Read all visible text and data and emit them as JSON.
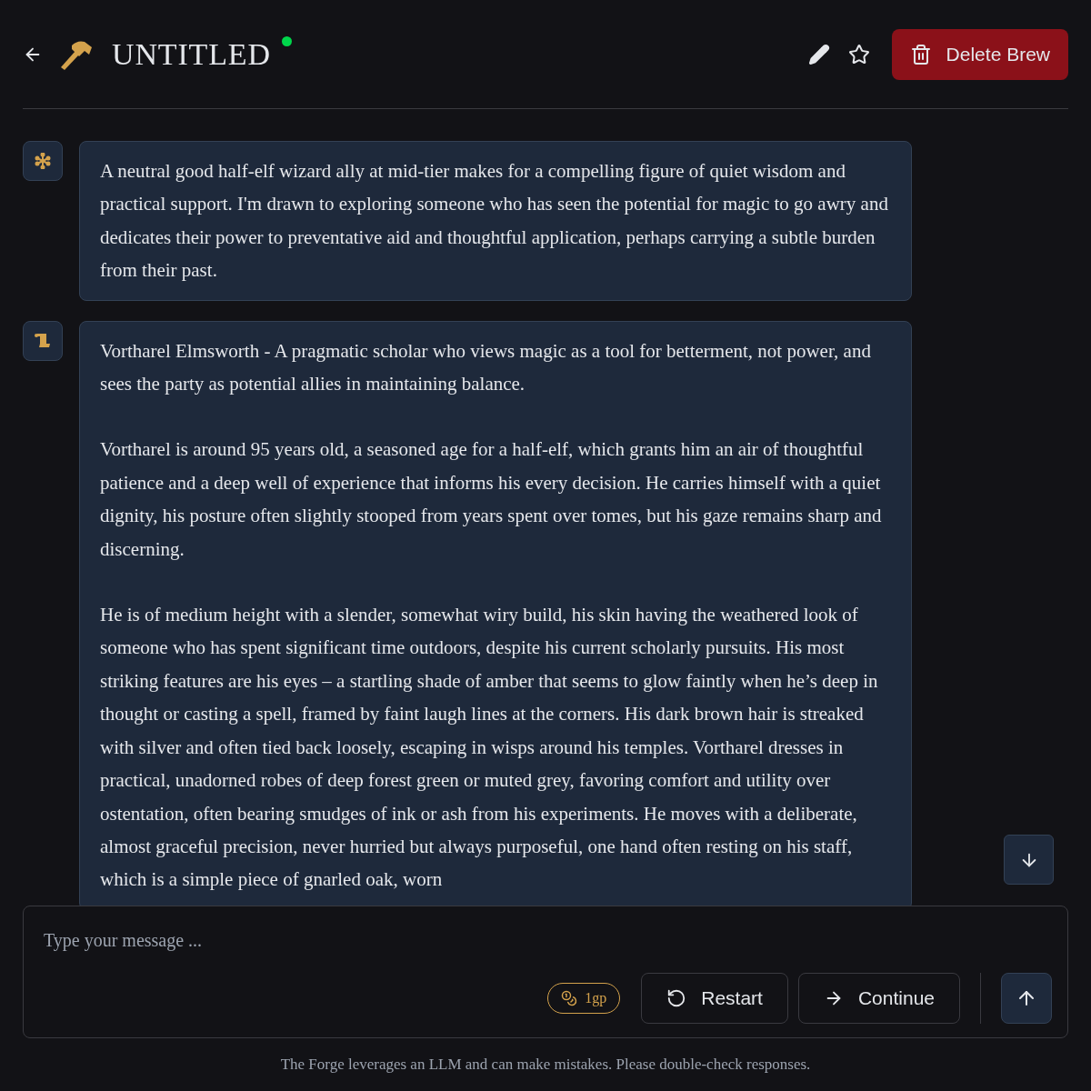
{
  "header": {
    "title": "UNTITLED",
    "online": true,
    "delete_button": "Delete Brew"
  },
  "messages": [
    {
      "kind": "prompt",
      "paragraphs": [
        "A neutral good half-elf wizard ally at mid-tier makes for a compelling figure of quiet wisdom and practical support. I'm drawn to exploring someone who has seen the potential for magic to go awry and dedicates their power to preventative aid and thoughtful application, perhaps carrying a subtle burden from their past."
      ]
    },
    {
      "kind": "response",
      "paragraphs": [
        "Vortharel Elmsworth - A pragmatic scholar who views magic as a tool for betterment, not power, and sees the party as potential allies in maintaining balance.",
        "Vortharel is around 95 years old, a seasoned age for a half-elf, which grants him an air of thoughtful patience and a deep well of experience that informs his every decision. He carries himself with a quiet dignity, his posture often slightly stooped from years spent over tomes, but his gaze remains sharp and discerning.",
        "He is of medium height with a slender, somewhat wiry build, his skin having the weathered look of someone who has spent significant time outdoors, despite his current scholarly pursuits. His most striking features are his eyes – a startling shade of amber that seems to glow faintly when he’s deep in thought or casting a spell, framed by faint laugh lines at the corners. His dark brown hair is streaked with silver and often tied back loosely, escaping in wisps around his temples. Vortharel dresses in practical, unadorned robes of deep forest green or muted grey, favoring comfort and utility over ostentation, often bearing smudges of ink or ash from his experiments. He moves with a deliberate, almost graceful precision, never hurried but always purposeful, one hand often resting on his staff, which is a simple piece of gnarled oak, worn"
      ]
    }
  ],
  "composer": {
    "placeholder": "Type your message ...",
    "cost": "1gp",
    "buttons": [
      {
        "kind": "restart",
        "label": "Restart"
      },
      {
        "kind": "continue",
        "label": "Continue"
      }
    ]
  },
  "footer": "The Forge leverages an LLM and can make mistakes. Please double-check responses."
}
